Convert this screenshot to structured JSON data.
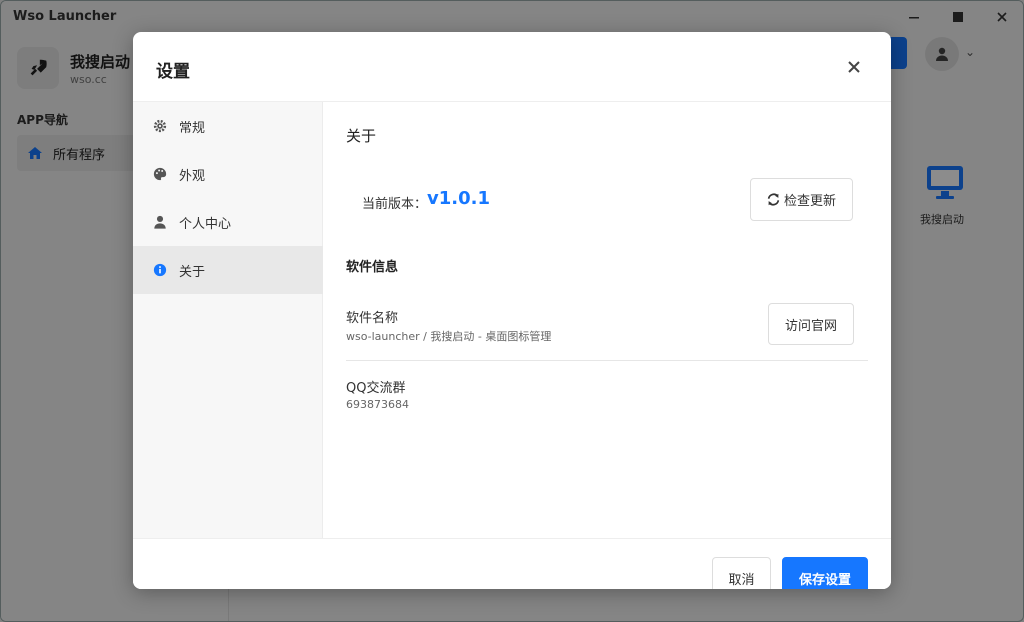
{
  "window": {
    "title": "Wso Launcher"
  },
  "sidebar": {
    "app_name": "我搜启动",
    "app_domain": "wso.cc",
    "nav_heading": "APP导航",
    "items": [
      {
        "label": "所有程序",
        "icon": "home-icon"
      }
    ]
  },
  "desktop": {
    "icons": [
      {
        "label": "我搜启动",
        "icon": "monitor-icon"
      }
    ]
  },
  "dialog": {
    "title": "设置",
    "menu": [
      {
        "label": "常规",
        "icon": "gear-icon"
      },
      {
        "label": "外观",
        "icon": "palette-icon"
      },
      {
        "label": "个人中心",
        "icon": "user-icon"
      },
      {
        "label": "关于",
        "icon": "info-icon",
        "active": true
      }
    ],
    "about": {
      "section_title": "关于",
      "version_label": "当前版本：",
      "version_value": "v1.0.1",
      "check_update_label": "检查更新",
      "info_title": "软件信息",
      "software_name_label": "软件名称",
      "software_name_value": "wso-launcher / 我搜启动 - 桌面图标管理",
      "visit_site_label": "访问官网",
      "qq_group_label": "QQ交流群",
      "qq_group_value": "693873684"
    },
    "footer": {
      "cancel_label": "取消",
      "save_label": "保存设置"
    }
  },
  "colors": {
    "accent": "#1677ff"
  }
}
